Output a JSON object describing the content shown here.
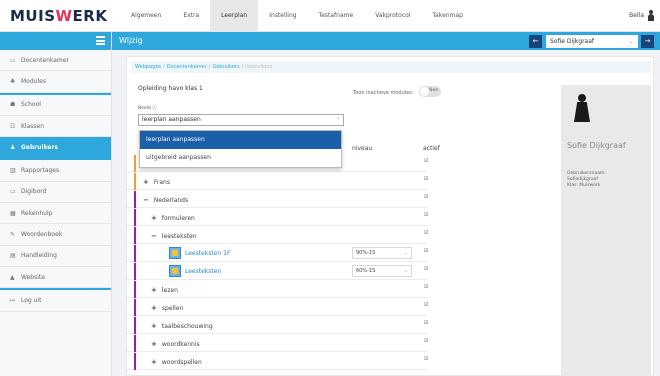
{
  "app": {
    "logo_a": "MUIS",
    "logo_b": "W",
    "logo_c": "ERK"
  },
  "topnav": [
    "Algemeen",
    "Extra",
    "Leerplan",
    "Instelling",
    "Testafname",
    "Vakprotocol",
    "Takenmap"
  ],
  "topnav_active": 2,
  "user": {
    "name": "Bella"
  },
  "sidebar": {
    "items": [
      {
        "icon": "▭",
        "label": "Docentenkamer"
      },
      {
        "icon": "♣",
        "label": "Modules"
      },
      {
        "icon": "☗",
        "label": "School"
      },
      {
        "icon": "☷",
        "label": "Klassen"
      },
      {
        "icon": "♟",
        "label": "Gebruikers",
        "active": true
      },
      {
        "icon": "▥",
        "label": "Rapportages"
      },
      {
        "icon": "▭",
        "label": "Digibord"
      },
      {
        "icon": "▦",
        "label": "Rekenhulp"
      },
      {
        "icon": "✎",
        "label": "Woordenboek"
      },
      {
        "icon": "▤",
        "label": "Handleiding"
      },
      {
        "icon": "▲",
        "label": "Website"
      },
      {
        "icon": "↦",
        "label": "Log uit"
      }
    ]
  },
  "titlebar": {
    "title": "Wijzig",
    "selected_user": "Sofie Dijkgraaf"
  },
  "breadcrumb": [
    "Webpages",
    "Docentenkamer",
    "Gebruikers",
    "Gebruikers"
  ],
  "form": {
    "opleiding": "Opleiding havo klas 1",
    "toon_label": "Toon inactieve modules:",
    "toggle_text": "Nee",
    "beeld_label": "Beeld ⓘ",
    "select_value": "leerplan aanpassen",
    "options": [
      "leerplan aanpassen",
      "uitgebreid aanpassen"
    ]
  },
  "table": {
    "headers": {
      "niveau": "niveau",
      "actief": "actief"
    },
    "rows": [
      {
        "type": "group",
        "label": "Frans",
        "indent": 0,
        "color": "#f0a030",
        "checked": true
      },
      {
        "type": "group",
        "label": "Frans",
        "indent": 0,
        "color": "#f0a030",
        "checked": true
      },
      {
        "type": "open",
        "label": "Nederlands",
        "indent": 0,
        "color": "#8e24aa",
        "checked": true
      },
      {
        "type": "group",
        "label": "formuleren",
        "indent": 1,
        "color": "#8e24aa",
        "checked": true
      },
      {
        "type": "open",
        "label": "leesteksten",
        "indent": 1,
        "color": "#8e24aa",
        "checked": true
      },
      {
        "type": "item",
        "label": "Leesteksten 1F",
        "niveau": "90%-1S",
        "color": "#8e24aa",
        "checked": true
      },
      {
        "type": "item",
        "label": "Leesteksten",
        "niveau": "60%-1S",
        "color": "#8e24aa",
        "checked": true
      },
      {
        "type": "group",
        "label": "lezen",
        "indent": 1,
        "color": "#8e24aa",
        "checked": true
      },
      {
        "type": "group",
        "label": "spellen",
        "indent": 1,
        "color": "#8e24aa",
        "checked": true
      },
      {
        "type": "group",
        "label": "taalbeschouwing",
        "indent": 1,
        "color": "#8e24aa",
        "checked": true
      },
      {
        "type": "group",
        "label": "woordkennis",
        "indent": 1,
        "color": "#8e24aa",
        "checked": true
      },
      {
        "type": "group",
        "label": "woordspellen",
        "indent": 1,
        "color": "#8e24aa",
        "checked": true
      }
    ]
  },
  "card": {
    "name": "Sofie Dijkgraaf",
    "info": [
      "Gebruikersnaam:",
      "Sofiedijkgraaf",
      "Klas: Muiswerk"
    ]
  },
  "colors": {
    "accent": "#2ea7dd",
    "dark": "#16457a",
    "brand_pink": "#e8305f"
  }
}
